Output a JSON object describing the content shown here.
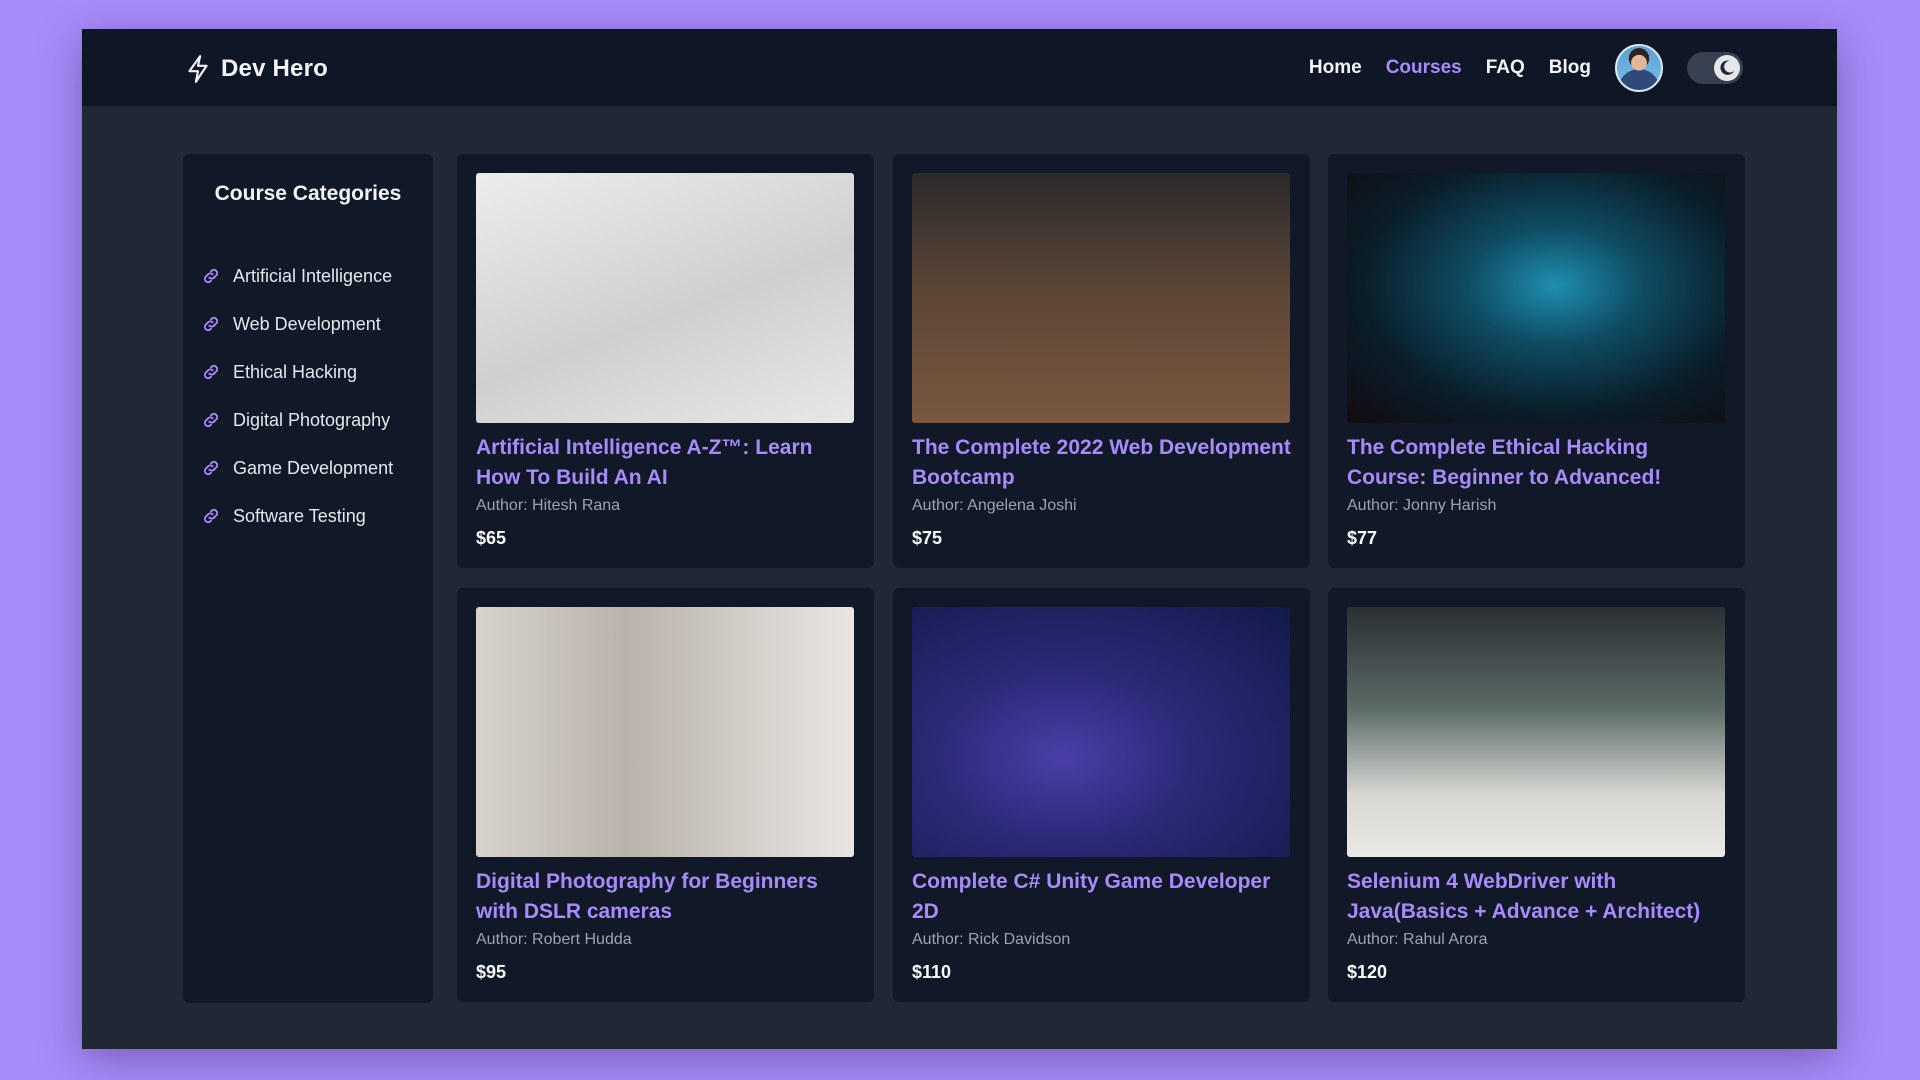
{
  "header": {
    "brand": "Dev Hero",
    "nav": [
      {
        "label": "Home",
        "active": false
      },
      {
        "label": "Courses",
        "active": true
      },
      {
        "label": "FAQ",
        "active": false
      },
      {
        "label": "Blog",
        "active": false
      }
    ],
    "theme": "dark"
  },
  "sidebar": {
    "title": "Course Categories",
    "items": [
      {
        "label": "Artificial Intelligence",
        "icon": "link-icon"
      },
      {
        "label": "Web Development",
        "icon": "link-icon"
      },
      {
        "label": "Ethical Hacking",
        "icon": "link-icon"
      },
      {
        "label": "Digital Photography",
        "icon": "link-icon"
      },
      {
        "label": "Game Development",
        "icon": "link-icon"
      },
      {
        "label": "Software Testing",
        "icon": "link-icon"
      }
    ]
  },
  "courses": [
    {
      "title": "Artificial Intelligence A-Z™: Learn How To Build An AI",
      "author": "Author: Hitesh Rana",
      "price": "$65"
    },
    {
      "title": "The Complete 2022 Web Development Bootcamp",
      "author": "Author: Angelena Joshi",
      "price": "$75"
    },
    {
      "title": "The Complete Ethical Hacking Course: Beginner to Advanced!",
      "author": "Author: Jonny Harish",
      "price": "$77"
    },
    {
      "title": "Digital Photography for Beginners with DSLR cameras",
      "author": "Author: Robert Hudda",
      "price": "$95"
    },
    {
      "title": "Complete C# Unity Game Developer 2D",
      "author": "Author: Rick Davidson",
      "price": "$110"
    },
    {
      "title": "Selenium 4 WebDriver with Java(Basics + Advance + Architect)",
      "author": "Author: Rahul Arora",
      "price": "$120"
    }
  ],
  "colors": {
    "accent": "#a78bfa",
    "backdrop": "#a78bfa",
    "navbar": "#0f1626",
    "panel": "#111828",
    "page": "#202735"
  }
}
